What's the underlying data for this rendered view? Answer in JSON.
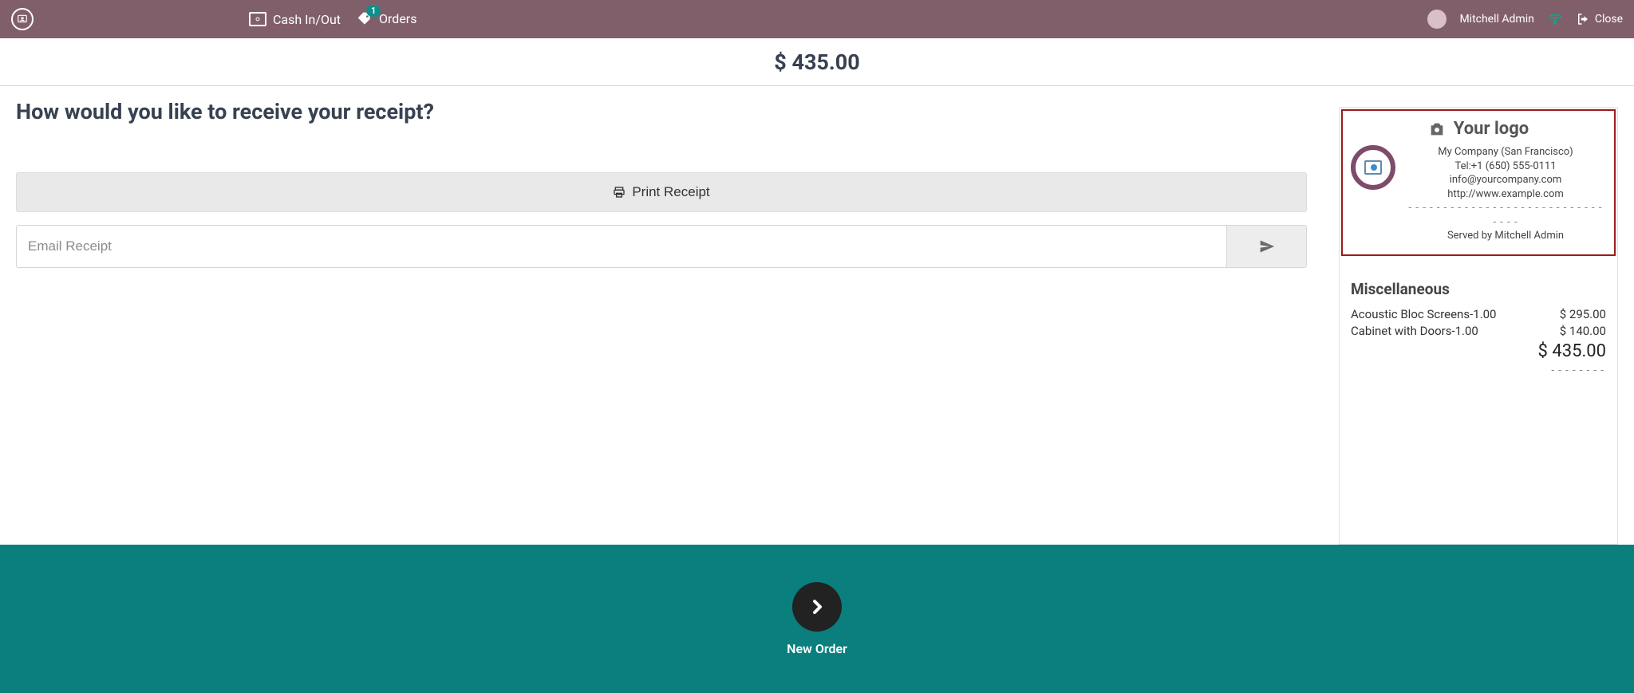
{
  "nav": {
    "cash_label": "Cash In/Out",
    "orders_label": "Orders",
    "orders_badge": "1",
    "user_name": "Mitchell Admin",
    "close_label": "Close"
  },
  "total_amount": "$ 435.00",
  "question": "How would you like to receive your receipt?",
  "buttons": {
    "print_label": "Print Receipt",
    "email_placeholder": "Email Receipt"
  },
  "receipt": {
    "logo_title": "Your logo",
    "company": "My Company (San Francisco)",
    "tel": "Tel:+1 (650) 555-0111",
    "email": "info@yourcompany.com",
    "website": "http://www.example.com",
    "served_by": "Served by Mitchell Admin",
    "section_title": "Miscellaneous",
    "lines": [
      {
        "desc": "Acoustic Bloc Screens-1.00",
        "amount": "$ 295.00"
      },
      {
        "desc": "Cabinet with Doors-1.00",
        "amount": "$ 140.00"
      }
    ],
    "subtotal": "$ 435.00"
  },
  "footer": {
    "new_order_label": "New Order"
  }
}
